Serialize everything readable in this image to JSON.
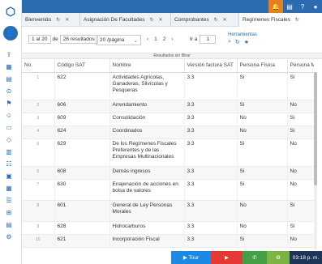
{
  "topbar": {
    "menu_icon": "menu-icon",
    "search_icon": "search-icon"
  },
  "tabs": [
    {
      "label": "Bienvenido"
    },
    {
      "label": "Asignación De Facultades"
    },
    {
      "label": "Comprobantes"
    },
    {
      "label": "Regímenes Fiscales"
    }
  ],
  "toolbar": {
    "range_from": "1 al 20",
    "range_of": "de",
    "range_total": "26 resultados",
    "per_page": "20 /página",
    "prev": "‹",
    "page1": "1",
    "page2": "2",
    "next": "›",
    "goto_label": "Ir a",
    "goto_value": "1",
    "tools_label": "Herramientas"
  },
  "filterbar": {
    "text": "Resultados sin filtrar"
  },
  "table": {
    "headers": [
      "No.",
      "Código SAT",
      "Nombre",
      "Versión factura SAT",
      "Persona Física",
      "Persona M"
    ],
    "rows": [
      [
        "1",
        "622",
        "Actividades Agrícolas, Ganaderas, Silvícolas y Pesqueras",
        "3.3",
        "Si",
        "Si"
      ],
      [
        "2",
        "606",
        "Arrendamiento",
        "3.3",
        "Si",
        "No"
      ],
      [
        "3",
        "609",
        "Consolidación",
        "3.3",
        "No",
        "Si"
      ],
      [
        "4",
        "624",
        "Coordinados",
        "3.3",
        "No",
        "Si"
      ],
      [
        "5",
        "629",
        "De los Regímenes Fiscales Preferentes y de las Empresas Multinacionales",
        "3.3",
        "Si",
        "No"
      ],
      [
        "6",
        "608",
        "Demás ingresos",
        "3.3",
        "Si",
        "No"
      ],
      [
        "7",
        "630",
        "Enajenación de acciones en bolsa de valores",
        "3.3",
        "Si",
        "No"
      ],
      [
        "8",
        "601",
        "General de Ley Personas Morales",
        "3.3",
        "No",
        "Si"
      ],
      [
        "9",
        "628",
        "Hidrocarburos",
        "3.3",
        "No",
        "Si"
      ],
      [
        "10",
        "621",
        "Incorporación Fiscal",
        "3.3",
        "Si",
        "No"
      ]
    ]
  },
  "footer": {
    "tour": "▶ Tour",
    "time": "03:18 p. m."
  }
}
